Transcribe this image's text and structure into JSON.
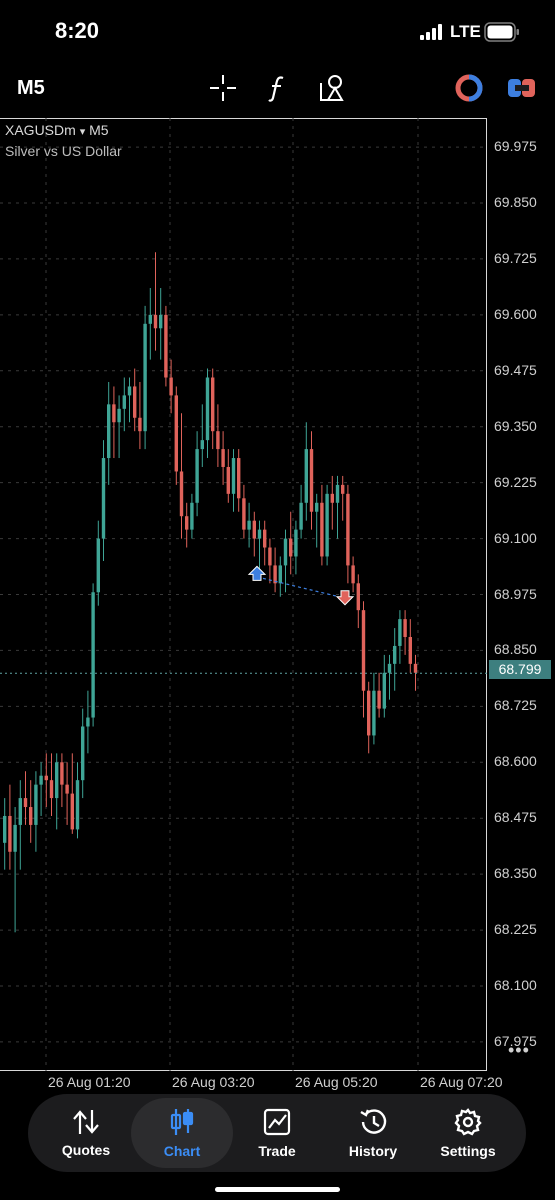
{
  "status": {
    "time": "8:20",
    "network": "LTE"
  },
  "toolbar": {
    "timeframe": "M5",
    "icons": [
      "crosshair-icon",
      "function-icon",
      "objects-icon",
      "one-click-trading-icon",
      "trade-toggle-icon"
    ]
  },
  "chart": {
    "symbol": "XAGUSDm",
    "dropdown_glyph": "▾",
    "timeframe": "M5",
    "description": "Silver vs US Dollar",
    "current_price": "68.799",
    "more_glyph": "•••",
    "colors": {
      "bull": "#3fa596",
      "bear": "#e0635b",
      "grid": "#3a3a3a",
      "price_line": "#5fa3a3",
      "trade_line": "#3d7fe0"
    }
  },
  "chart_data": {
    "type": "candlestick",
    "title": "XAGUSDm",
    "subtitle": "Silver vs US Dollar",
    "ylim": [
      67.91,
      70.04
    ],
    "y_ticks": [
      "69.975",
      "69.850",
      "69.725",
      "69.600",
      "69.475",
      "69.350",
      "69.225",
      "69.100",
      "68.975",
      "68.850",
      "68.725",
      "68.600",
      "68.475",
      "68.350",
      "68.225",
      "68.100",
      "67.975"
    ],
    "x_ticks": [
      "26 Aug 01:20",
      "26 Aug 03:20",
      "26 Aug 05:20",
      "26 Aug 07:20"
    ],
    "last_price": 68.799,
    "candles_ohlc": [
      [
        68.42,
        68.52,
        68.36,
        68.48
      ],
      [
        68.48,
        68.55,
        68.36,
        68.4
      ],
      [
        68.4,
        68.5,
        68.22,
        68.46
      ],
      [
        68.46,
        68.56,
        68.36,
        68.52
      ],
      [
        68.52,
        68.58,
        68.46,
        68.5
      ],
      [
        68.5,
        68.56,
        68.42,
        68.46
      ],
      [
        68.46,
        68.58,
        68.4,
        68.55
      ],
      [
        68.55,
        68.6,
        68.48,
        68.57
      ],
      [
        68.57,
        68.62,
        68.5,
        68.56
      ],
      [
        68.56,
        68.62,
        68.48,
        68.52
      ],
      [
        68.52,
        68.62,
        68.45,
        68.6
      ],
      [
        68.6,
        68.62,
        68.5,
        68.55
      ],
      [
        68.55,
        68.6,
        68.46,
        68.53
      ],
      [
        68.53,
        68.62,
        68.44,
        68.45
      ],
      [
        68.45,
        68.6,
        68.43,
        68.56
      ],
      [
        68.56,
        68.72,
        68.52,
        68.68
      ],
      [
        68.68,
        68.76,
        68.62,
        68.7
      ],
      [
        68.7,
        69.0,
        68.68,
        68.98
      ],
      [
        68.98,
        69.14,
        68.95,
        69.1
      ],
      [
        69.1,
        69.32,
        69.05,
        69.28
      ],
      [
        69.28,
        69.45,
        69.22,
        69.4
      ],
      [
        69.4,
        69.44,
        69.28,
        69.36
      ],
      [
        69.36,
        69.42,
        69.28,
        69.39
      ],
      [
        69.39,
        69.46,
        69.34,
        69.42
      ],
      [
        69.42,
        69.46,
        69.36,
        69.44
      ],
      [
        69.44,
        69.48,
        69.34,
        69.37
      ],
      [
        69.37,
        69.45,
        69.3,
        69.34
      ],
      [
        69.34,
        69.62,
        69.3,
        69.58
      ],
      [
        69.58,
        69.66,
        69.5,
        69.6
      ],
      [
        69.6,
        69.74,
        69.52,
        69.57
      ],
      [
        69.57,
        69.66,
        69.5,
        69.6
      ],
      [
        69.6,
        69.62,
        69.44,
        69.46
      ],
      [
        69.46,
        69.5,
        69.38,
        69.42
      ],
      [
        69.42,
        69.44,
        69.22,
        69.25
      ],
      [
        69.25,
        69.38,
        69.1,
        69.15
      ],
      [
        69.15,
        69.18,
        69.08,
        69.12
      ],
      [
        69.12,
        69.2,
        69.1,
        69.18
      ],
      [
        69.18,
        69.34,
        69.15,
        69.3
      ],
      [
        69.3,
        69.4,
        69.26,
        69.32
      ],
      [
        69.32,
        69.48,
        69.28,
        69.46
      ],
      [
        69.46,
        69.48,
        69.3,
        69.34
      ],
      [
        69.34,
        69.4,
        69.26,
        69.3
      ],
      [
        69.3,
        69.34,
        69.22,
        69.26
      ],
      [
        69.26,
        69.3,
        69.18,
        69.2
      ],
      [
        69.2,
        69.3,
        69.16,
        69.28
      ],
      [
        69.28,
        69.3,
        69.16,
        69.19
      ],
      [
        69.19,
        69.22,
        69.1,
        69.12
      ],
      [
        69.12,
        69.18,
        69.08,
        69.14
      ],
      [
        69.14,
        69.16,
        69.06,
        69.1
      ],
      [
        69.1,
        69.14,
        69.03,
        69.12
      ],
      [
        69.12,
        69.14,
        69.04,
        69.08
      ],
      [
        69.08,
        69.1,
        69.0,
        69.04
      ],
      [
        69.04,
        69.08,
        68.98,
        69.0
      ],
      [
        69.0,
        69.06,
        68.97,
        69.04
      ],
      [
        69.04,
        69.12,
        68.98,
        69.1
      ],
      [
        69.1,
        69.16,
        69.02,
        69.06
      ],
      [
        69.06,
        69.14,
        69.02,
        69.12
      ],
      [
        69.12,
        69.22,
        69.1,
        69.18
      ],
      [
        69.18,
        69.36,
        69.14,
        69.3
      ],
      [
        69.3,
        69.34,
        69.12,
        69.16
      ],
      [
        69.16,
        69.2,
        69.08,
        69.18
      ],
      [
        69.18,
        69.22,
        69.04,
        69.06
      ],
      [
        69.06,
        69.22,
        69.04,
        69.2
      ],
      [
        69.2,
        69.24,
        69.12,
        69.18
      ],
      [
        69.18,
        69.24,
        69.1,
        69.22
      ],
      [
        69.22,
        69.24,
        69.14,
        69.2
      ],
      [
        69.2,
        69.22,
        69.0,
        69.04
      ],
      [
        69.04,
        69.06,
        68.98,
        69.0
      ],
      [
        69.0,
        69.02,
        68.9,
        68.94
      ],
      [
        68.94,
        68.96,
        68.7,
        68.76
      ],
      [
        68.76,
        68.78,
        68.62,
        68.66
      ],
      [
        68.66,
        68.8,
        68.64,
        68.76
      ],
      [
        68.76,
        68.8,
        68.7,
        68.72
      ],
      [
        68.72,
        68.84,
        68.7,
        68.8
      ],
      [
        68.8,
        68.84,
        68.74,
        68.82
      ],
      [
        68.82,
        68.9,
        68.76,
        68.86
      ],
      [
        68.86,
        68.94,
        68.82,
        68.92
      ],
      [
        68.92,
        68.94,
        68.84,
        68.88
      ],
      [
        68.88,
        68.92,
        68.8,
        68.82
      ],
      [
        68.82,
        68.84,
        68.76,
        68.8
      ]
    ],
    "trade_markers": [
      {
        "type": "buy",
        "price": 69.02
      },
      {
        "type": "sell",
        "price": 68.97
      }
    ]
  },
  "tabs": [
    {
      "label": "Quotes",
      "icon": "quotes-icon",
      "active": false
    },
    {
      "label": "Chart",
      "icon": "chart-icon",
      "active": true
    },
    {
      "label": "Trade",
      "icon": "trade-icon",
      "active": false
    },
    {
      "label": "History",
      "icon": "history-icon",
      "active": false
    },
    {
      "label": "Settings",
      "icon": "settings-icon",
      "active": false
    }
  ]
}
